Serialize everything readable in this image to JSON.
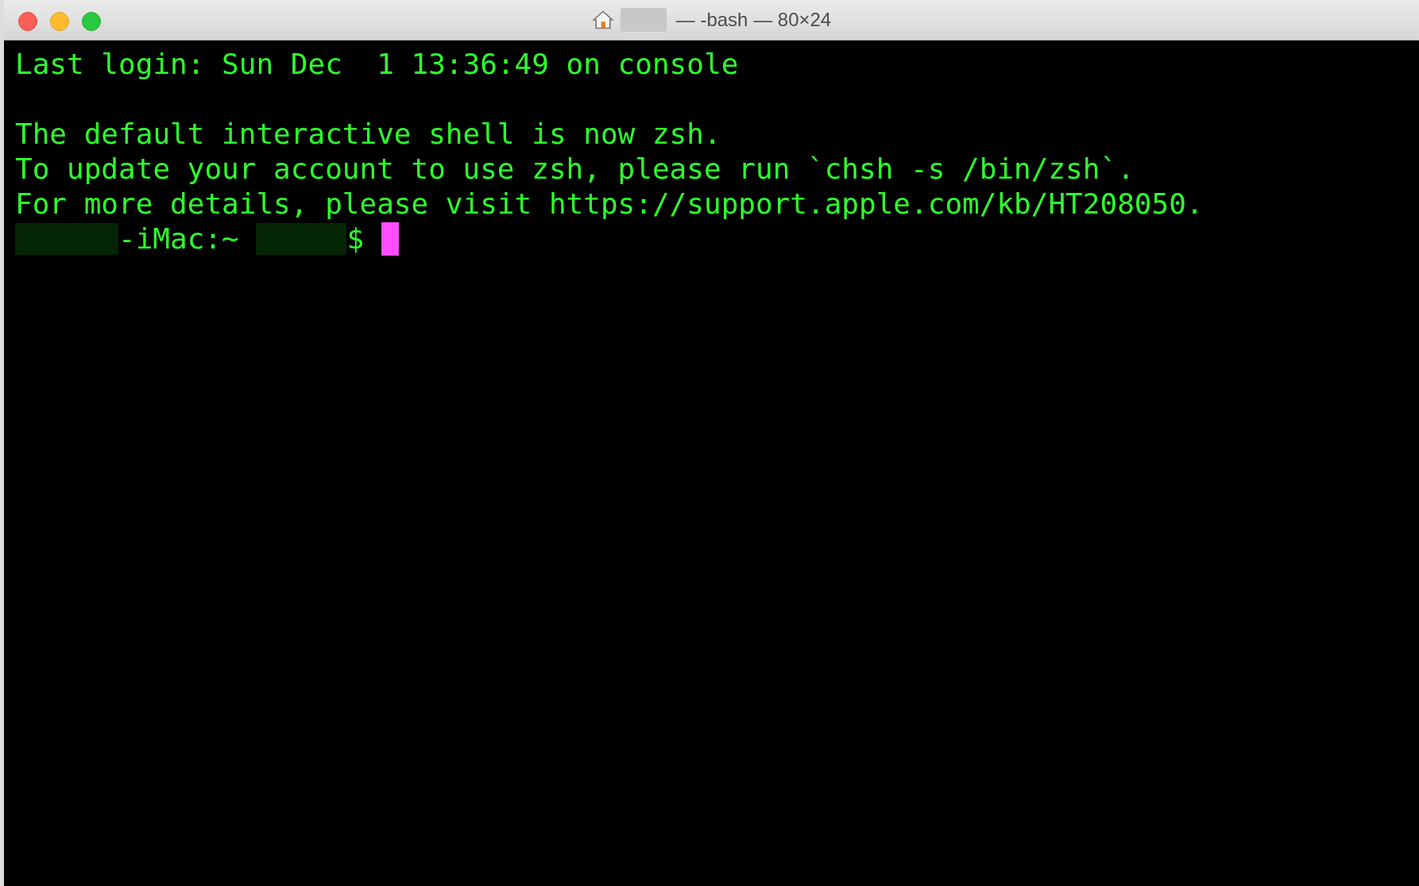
{
  "window": {
    "title": "— -bash — 80×24"
  },
  "terminal": {
    "lines": [
      {
        "kind": "text",
        "text": "Last login: Sun Dec  1 13:36:49 on console"
      },
      {
        "kind": "blank"
      },
      {
        "kind": "text",
        "text": "The default interactive shell is now zsh."
      },
      {
        "kind": "text",
        "text": "To update your account to use zsh, please run `chsh -s /bin/zsh`."
      },
      {
        "kind": "text",
        "text": "For more details, please visit https://support.apple.com/kb/HT208050."
      }
    ],
    "prompt": [
      {
        "kind": "redacted"
      },
      {
        "kind": "text",
        "text": "-iMac:~ "
      },
      {
        "kind": "redacted"
      },
      {
        "kind": "text",
        "text": "$ "
      },
      {
        "kind": "cursor"
      }
    ]
  }
}
